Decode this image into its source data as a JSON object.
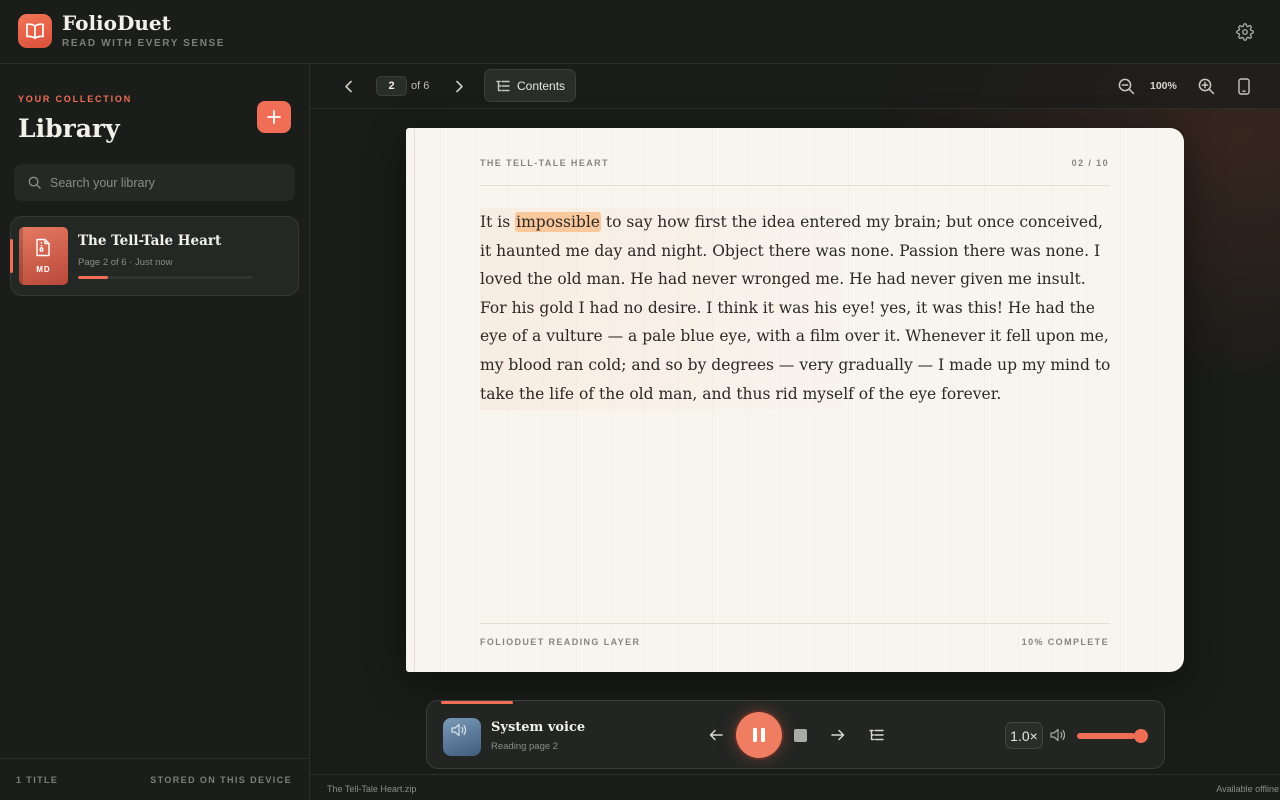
{
  "app": {
    "name": "FolioDuet",
    "tagline": "READ WITH EVERY SENSE"
  },
  "sidebar": {
    "collection_label": "YOUR COLLECTION",
    "heading": "Library",
    "search_placeholder": "Search your library",
    "books": [
      {
        "title": "The Tell-Tale Heart",
        "format": "MD",
        "meta": "Page 2 of 6 · Just now",
        "progress": 0.17
      }
    ],
    "footer_count": "1 TITLE",
    "footer_storage": "STORED ON THIS DEVICE"
  },
  "toolbar": {
    "current_page": "2",
    "page_of": "of 6",
    "contents_label": "Contents",
    "zoom": "100%"
  },
  "page": {
    "running_title": "THE TELL-TALE HEART",
    "page_counter": "02 / 10",
    "text_before": "It is ",
    "highlighted_word": "impossible",
    "text_after": " to say how first the idea entered my brain; but once conceived, it haunted me day and night. Object there was none. Passion there was none. I loved the old man. He had never wronged me. He had never given me insult. For his gold I had no desire. I think it was his eye! yes, it was this! He had the eye of a vulture — a pale blue eye, with a film over it. Whenever it fell upon me, my blood ran cold; and so by degrees — very gradually — I made up my mind to take the life of the old man, and thus rid myself of the eye forever.",
    "footer_left": "FOLIODUET READING LAYER",
    "footer_right": "10% COMPLETE"
  },
  "player": {
    "voice_name": "System voice",
    "voice_status": "Reading page 2",
    "speed": "1.0×",
    "volume": 0.88,
    "playback_progress": 0.1
  },
  "status_bar": {
    "file_name": "The Tell-Tale Heart.zip",
    "availability": "Available offline"
  },
  "colors": {
    "accent": "#ef6e55",
    "highlight": "#f9c89c",
    "paper": "#f8f5ef",
    "background": "#1c1e1c"
  },
  "icons": {
    "logo": "open-book-icon",
    "settings": "gear-icon",
    "add": "plus-icon",
    "search": "search-icon",
    "contents": "list-icon",
    "zoom_out": "zoom-out-icon",
    "zoom_in": "zoom-in-icon",
    "device": "phone-icon",
    "pause": "pause-icon",
    "stop": "stop-icon",
    "volume": "speaker-icon"
  }
}
